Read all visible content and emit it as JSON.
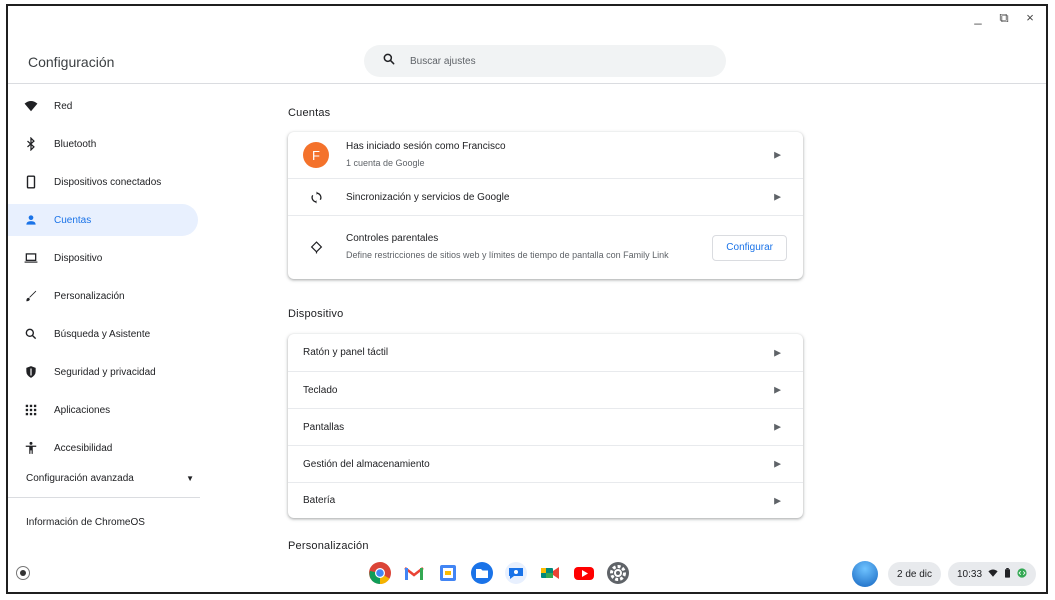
{
  "window": {
    "minimize": "_",
    "maximize": "⧉",
    "close": "×"
  },
  "header": {
    "title": "Configuración",
    "search_placeholder": "Buscar ajustes"
  },
  "sidebar": {
    "items": [
      {
        "label": "Red",
        "icon": "wifi-icon"
      },
      {
        "label": "Bluetooth",
        "icon": "bluetooth-icon"
      },
      {
        "label": "Dispositivos conectados",
        "icon": "phone-icon"
      },
      {
        "label": "Cuentas",
        "icon": "person-icon",
        "active": true
      },
      {
        "label": "Dispositivo",
        "icon": "laptop-icon"
      },
      {
        "label": "Personalización",
        "icon": "brush-icon"
      },
      {
        "label": "Búsqueda y Asistente",
        "icon": "search-icon"
      },
      {
        "label": "Seguridad y privacidad",
        "icon": "shield-icon"
      },
      {
        "label": "Aplicaciones",
        "icon": "apps-grid-icon"
      },
      {
        "label": "Accesibilidad",
        "icon": "accessibility-icon"
      }
    ],
    "advanced": "Configuración avanzada",
    "about": "Información de ChromeOS"
  },
  "accounts": {
    "title": "Cuentas",
    "user": {
      "avatar_letter": "F",
      "primary": "Has iniciado sesión como Francisco",
      "secondary": "1 cuenta de Google"
    },
    "sync": "Sincronización y servicios de Google",
    "parental": {
      "primary": "Controles parentales",
      "secondary": "Define restricciones de sitios web y límites de tiempo de pantalla con Family Link",
      "button": "Configurar"
    }
  },
  "device": {
    "title": "Dispositivo",
    "rows": [
      "Ratón y panel táctil",
      "Teclado",
      "Pantallas",
      "Gestión del almacenamiento",
      "Batería"
    ]
  },
  "personalization": {
    "title": "Personalización"
  },
  "shelf": {
    "apps": [
      "chrome-icon",
      "gmail-icon",
      "calendar-icon",
      "files-icon",
      "messages-icon",
      "meet-icon",
      "youtube-icon",
      "settings-icon"
    ],
    "date": "2 de dic",
    "time": "10:33"
  },
  "colors": {
    "accent": "#1a73e8",
    "active_bg": "#e8f0fe",
    "avatar": "#f4722b"
  }
}
